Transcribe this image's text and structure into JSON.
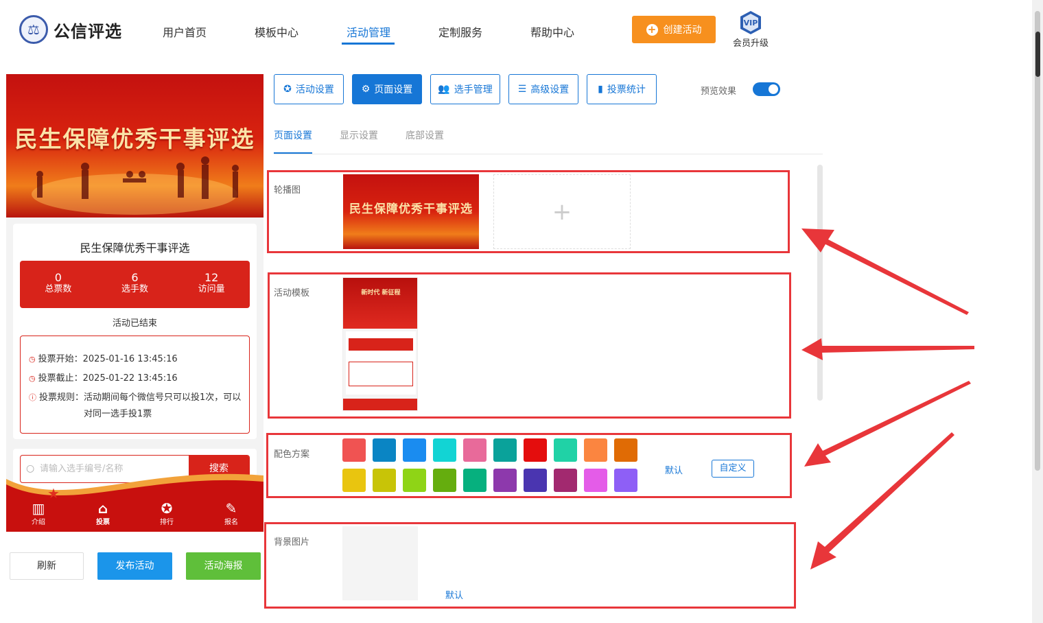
{
  "brand": {
    "name": "公信评选"
  },
  "nav": {
    "items": [
      {
        "label": "用户首页"
      },
      {
        "label": "模板中心"
      },
      {
        "label": "活动管理"
      },
      {
        "label": "定制服务"
      },
      {
        "label": "帮助中心"
      }
    ],
    "active": "活动管理",
    "create_label": "创建活动",
    "vip_badge": "VIP",
    "vip_label": "会员升级"
  },
  "preview": {
    "banner_title": "民生保障优秀干事评选",
    "activity_title": "民生保障优秀干事评选",
    "stats": [
      {
        "value": "0",
        "label": "总票数"
      },
      {
        "value": "6",
        "label": "选手数"
      },
      {
        "value": "12",
        "label": "访问量"
      }
    ],
    "status": "活动已结束",
    "rules": [
      {
        "label": "投票开始：",
        "value": "2025-01-16 13:45:16"
      },
      {
        "label": "投票截止：",
        "value": "2025-01-22 13:45:16"
      },
      {
        "label": "投票规则：",
        "value": "活动期间每个微信号只可以投1次，可以对同一选手投1票"
      }
    ],
    "search_placeholder": "请输入选手编号/名称",
    "search_button": "搜索",
    "tabs": [
      {
        "label": "介绍",
        "icon": "book-icon"
      },
      {
        "label": "投票",
        "icon": "home-icon"
      },
      {
        "label": "排行",
        "icon": "ranking-icon"
      },
      {
        "label": "报名",
        "icon": "signup-icon"
      }
    ]
  },
  "actions": {
    "refresh": "刷新",
    "publish": "发布活动",
    "poster": "活动海报"
  },
  "toolbar": {
    "buttons": [
      {
        "label": "活动设置",
        "icon": "star-icon"
      },
      {
        "label": "页面设置",
        "icon": "gear-icon"
      },
      {
        "label": "选手管理",
        "icon": "users-icon"
      },
      {
        "label": "高级设置",
        "icon": "settings-list-icon"
      },
      {
        "label": "投票统计",
        "icon": "bar-chart-icon"
      }
    ],
    "active": "页面设置",
    "preview_label": "预览效果",
    "preview_on": true
  },
  "subtabs": {
    "items": [
      "页面设置",
      "显示设置",
      "底部设置"
    ],
    "active": "页面设置"
  },
  "sections": {
    "carousel": {
      "label": "轮播图",
      "image_title": "民生保障优秀干事评选"
    },
    "template": {
      "label": "活动模板",
      "thumb_title": "新时代 新征程"
    },
    "colors": {
      "label": "配色方案",
      "row1": [
        "#f05352",
        "#0a85c4",
        "#1a8cf0",
        "#12d4d4",
        "#e86a9a",
        "#0aa29a",
        "#e40d0d",
        "#20d2a6",
        "#fb8540",
        "#e06b05"
      ],
      "row2": [
        "#e9c50f",
        "#c8c407",
        "#8fd416",
        "#65ad0e",
        "#06b07e",
        "#8d39ac",
        "#4a35b0",
        "#a2296f",
        "#e45ce8",
        "#8e5ff6"
      ],
      "default_label": "默认",
      "custom_label": "自定义"
    },
    "background": {
      "label": "背景图片",
      "default_label": "默认"
    }
  },
  "colors": {
    "accent": "#1676d6",
    "brand_red": "#d8231a",
    "annotation": "#e8363a"
  }
}
